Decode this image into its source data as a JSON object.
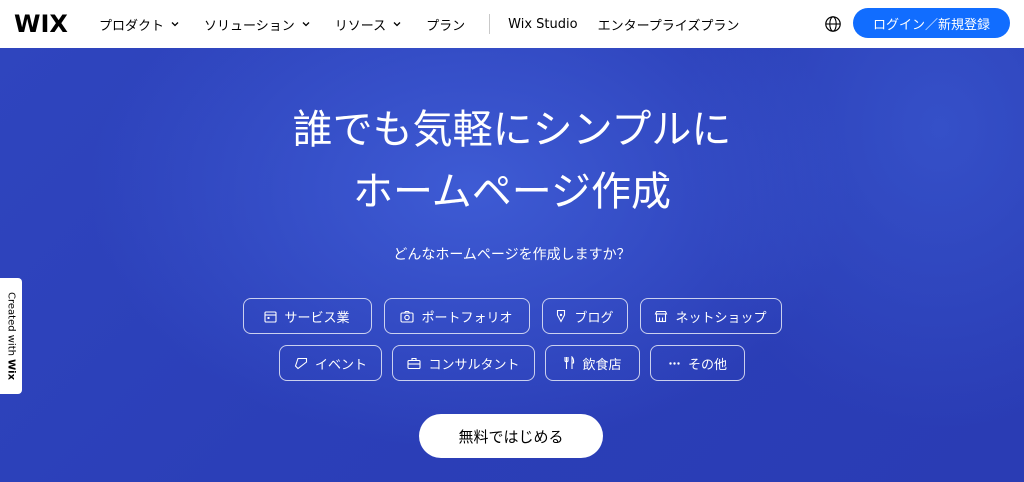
{
  "header": {
    "logo": "WIX",
    "nav": [
      {
        "label": "プロダクト",
        "dropdown": true
      },
      {
        "label": "ソリューション",
        "dropdown": true
      },
      {
        "label": "リソース",
        "dropdown": true
      },
      {
        "label": "プラン",
        "dropdown": false
      }
    ],
    "nav_secondary": [
      {
        "label": "Wix Studio"
      },
      {
        "label": "エンタープライズプラン"
      }
    ],
    "globe_icon": "globe-icon",
    "login_label": "ログイン／新規登録"
  },
  "hero": {
    "headline_line1": "誰でも気軽にシンプルに",
    "headline_line2": "ホームページ作成",
    "subline": "どんなホームページを作成しますか？",
    "chips_row1": [
      {
        "label": "サービス業",
        "icon": "calendar-icon"
      },
      {
        "label": "ポートフォリオ",
        "icon": "camera-icon"
      },
      {
        "label": "ブログ",
        "icon": "pen-icon"
      },
      {
        "label": "ネットショップ",
        "icon": "store-icon"
      }
    ],
    "chips_row2": [
      {
        "label": "イベント",
        "icon": "ticket-icon"
      },
      {
        "label": "コンサルタント",
        "icon": "briefcase-icon"
      },
      {
        "label": "飲食店",
        "icon": "cutlery-icon"
      },
      {
        "label": "その他",
        "icon": "more-icon"
      }
    ],
    "cta_label": "無料ではじめる",
    "side_tab_text": "Created with ",
    "side_tab_brand": "Wix"
  },
  "colors": {
    "hero_bg": "#2f45be",
    "login_bg": "#116dff"
  }
}
